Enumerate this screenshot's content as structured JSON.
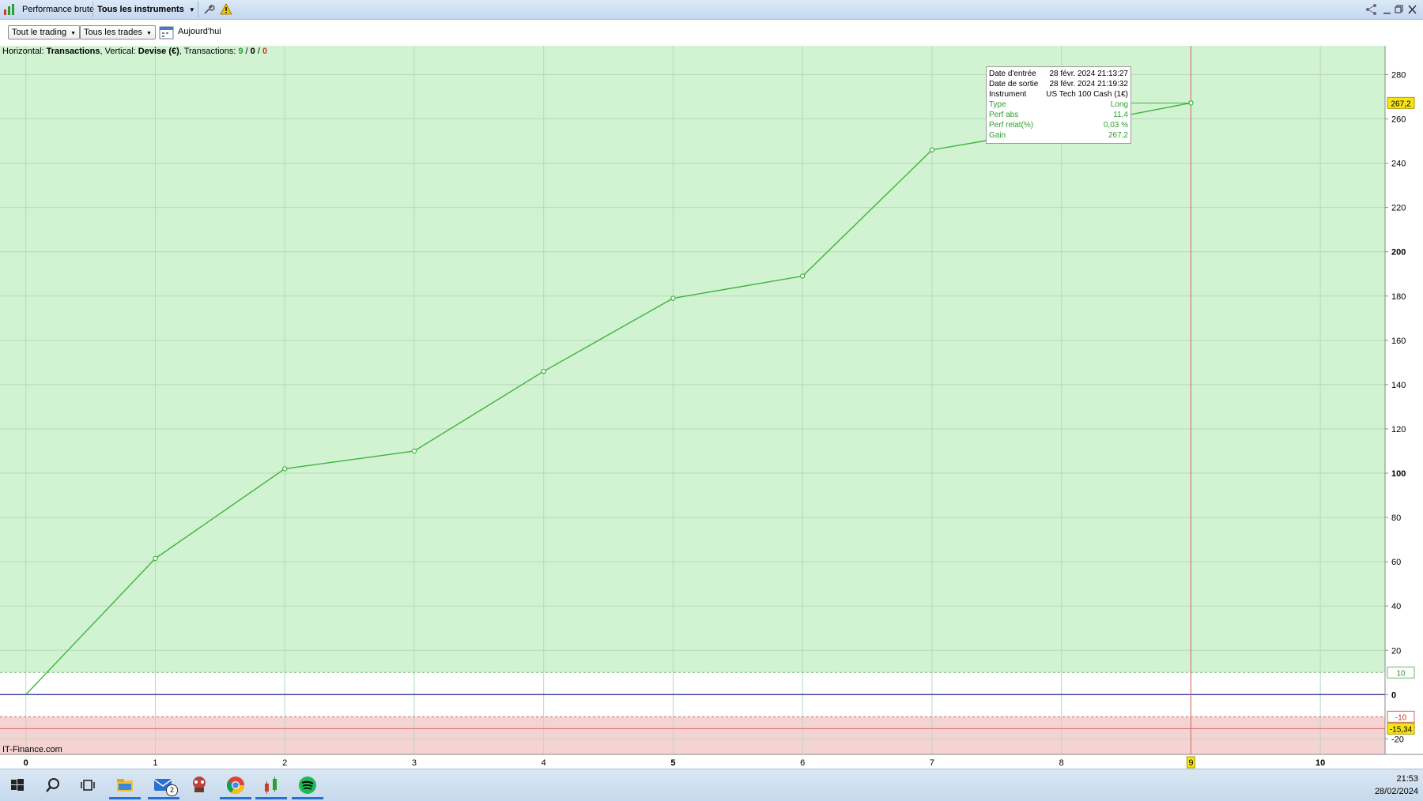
{
  "titlebar": {
    "view_label": "Performance brute",
    "instrument_selector": "Tous les instruments",
    "window_controls": [
      "share-icon",
      "minimize-icon",
      "restore-icon",
      "close-icon"
    ]
  },
  "toolbar": {
    "period_dropdown": "Tout le trading",
    "trades_dropdown": "Tous les trades",
    "date_label": "Aujourd'hui"
  },
  "info_line": {
    "prefix": "Horizontal: ",
    "horizontal": "Transactions",
    "mid1": ", Vertical: ",
    "vertical": "Devise (€)",
    "mid2": ", Transactions: ",
    "count_total": "9",
    "sep1": " / ",
    "count_mid": "0",
    "sep2": " / ",
    "count_loss": "0"
  },
  "watermark": "IT-Finance.com",
  "tooltip": {
    "rows": [
      {
        "key": "Date d'entrée",
        "value": "28 févr. 2024 21:13:27",
        "color": "#000000"
      },
      {
        "key": "Date de sortie",
        "value": "28 févr. 2024 21:19:32",
        "color": "#000000"
      },
      {
        "key": "Instrument",
        "value": "US Tech 100 Cash (1€)",
        "color": "#000000"
      },
      {
        "key": "Type",
        "value": "Long",
        "color": "#2e9e2e"
      },
      {
        "key": "Perf abs",
        "value": "11,4",
        "color": "#2e9e2e"
      },
      {
        "key": "Perf relat(%)",
        "value": "0,03 %",
        "color": "#2e9e2e"
      },
      {
        "key": "Gain",
        "value": "267,2",
        "color": "#2e9e2e"
      }
    ]
  },
  "chart_data": {
    "type": "line",
    "x": [
      0,
      1,
      2,
      3,
      4,
      5,
      6,
      7,
      8,
      9
    ],
    "series": [
      {
        "values": [
          0,
          61.5,
          102,
          110,
          146,
          179,
          189,
          246,
          256,
          267.2
        ],
        "color": "#3cb43c"
      }
    ],
    "xlim": [
      -0.2,
      10.5
    ],
    "ylim": [
      -27,
      293
    ],
    "x_ticks": [
      "0",
      "1",
      "2",
      "3",
      "4",
      "5",
      "6",
      "7",
      "8",
      "9",
      "10"
    ],
    "y_ticks": [
      -20,
      0,
      20,
      40,
      60,
      80,
      100,
      120,
      140,
      160,
      180,
      200,
      220,
      240,
      260,
      280
    ],
    "y_tick_labels": [
      "-20",
      "0",
      "20",
      "40",
      "60",
      "80",
      "100",
      "120",
      "140",
      "160",
      "180",
      "200",
      "220",
      "240",
      "260",
      "280"
    ],
    "grid": true,
    "upper_threshold": {
      "value": 10,
      "label": "10"
    },
    "lower_threshold": {
      "value": -10,
      "label": "-10"
    },
    "min_marker": {
      "value": -15.34,
      "label": "-15,34"
    },
    "current_marker": {
      "value": 267.2,
      "label": "267,2"
    },
    "selected_x": {
      "value": 9,
      "label": "9"
    },
    "colors": {
      "gain_zone": "#d1f3d1",
      "loss_zone": "#f6d3d3",
      "line": "#3cb43c",
      "zero_line": "#3a3a9a",
      "cursor": "#e06060",
      "marker_bg": "#f7e318"
    }
  },
  "taskbar": {
    "icons": [
      "windows-start-icon",
      "search-icon",
      "task-view-icon",
      "file-explorer-icon",
      "mail-icon",
      "game-icon",
      "chrome-icon",
      "trading-app-icon",
      "spotify-icon"
    ],
    "mail_badge": "2",
    "time": "21:53",
    "date": "28/02/2024"
  }
}
